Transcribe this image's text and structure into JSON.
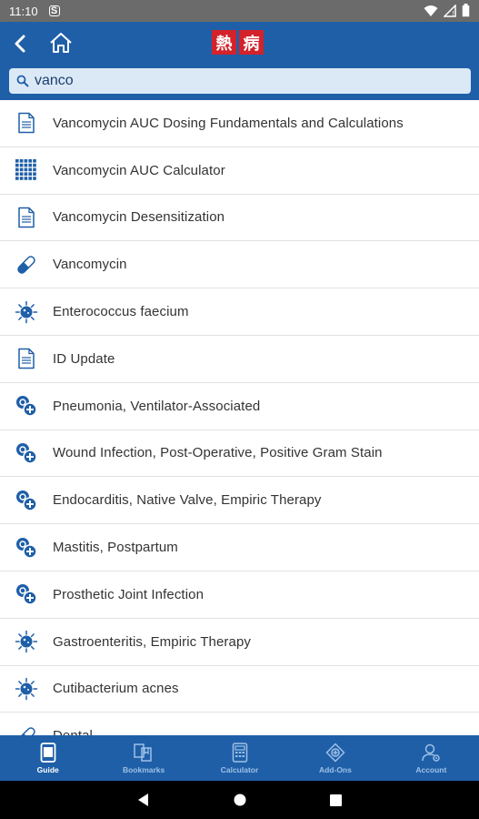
{
  "status_bar": {
    "time": "11:10",
    "sim_glyph": "S"
  },
  "search": {
    "value": "vanco"
  },
  "logo": {
    "char1": "熱",
    "char2": "病"
  },
  "results": [
    {
      "label": "Vancomycin AUC Dosing Fundamentals and Calculations",
      "icon": "document-icon"
    },
    {
      "label": "Vancomycin AUC Calculator",
      "icon": "calculator-grid-icon"
    },
    {
      "label": "Vancomycin Desensitization",
      "icon": "document-icon"
    },
    {
      "label": "Vancomycin",
      "icon": "drug-pill-icon"
    },
    {
      "label": "Enterococcus faecium",
      "icon": "pathogen-icon"
    },
    {
      "label": "ID Update",
      "icon": "document-icon"
    },
    {
      "label": "Pneumonia, Ventilator-Associated",
      "icon": "syndrome-icon"
    },
    {
      "label": "Wound Infection, Post-Operative, Positive Gram Stain",
      "icon": "syndrome-icon"
    },
    {
      "label": "Endocarditis, Native Valve, Empiric Therapy",
      "icon": "syndrome-icon"
    },
    {
      "label": "Mastitis, Postpartum",
      "icon": "syndrome-icon"
    },
    {
      "label": "Prosthetic Joint Infection",
      "icon": "syndrome-icon"
    },
    {
      "label": "Gastroenteritis, Empiric Therapy",
      "icon": "pathogen-icon"
    },
    {
      "label": "Cutibacterium acnes",
      "icon": "pathogen-icon"
    },
    {
      "label": "Dental...",
      "icon": "drug-pill-icon"
    }
  ],
  "bottom_nav": [
    {
      "label": "Guide",
      "active": true
    },
    {
      "label": "Bookmarks",
      "active": false
    },
    {
      "label": "Calculator",
      "active": false
    },
    {
      "label": "Add-Ons",
      "active": false
    },
    {
      "label": "Account",
      "active": false
    }
  ],
  "colors": {
    "header": "#1f5fa8",
    "accent": "#1f5fa8",
    "logo_red": "#d3222a"
  }
}
